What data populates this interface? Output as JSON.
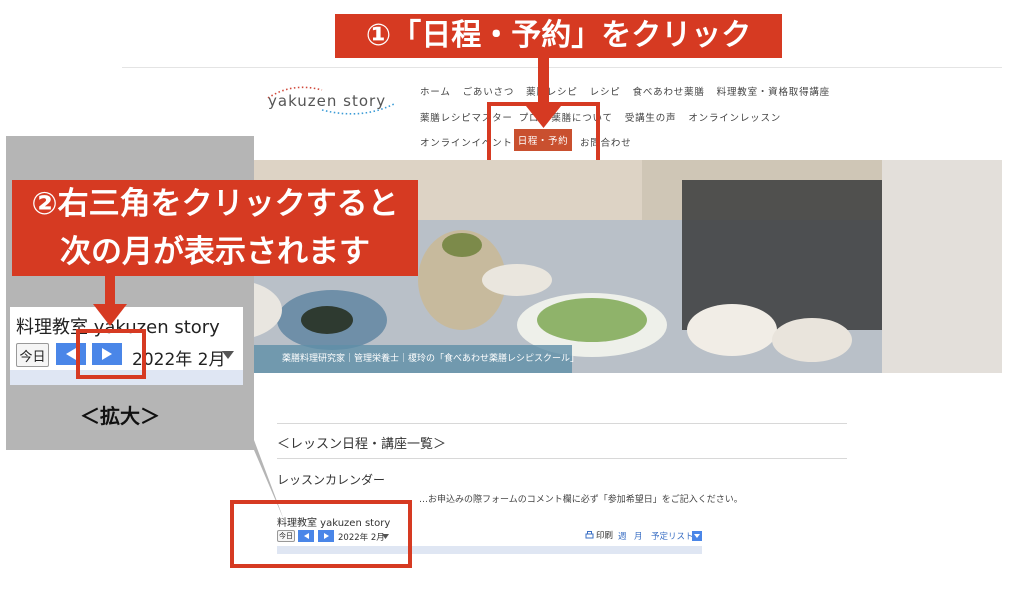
{
  "annotation_1": "①「日程・予約」をクリック",
  "annotation_2_line1": "②右三角をクリックすると",
  "annotation_2_line2": "次の月が表示されます",
  "zoom_caption": "＜拡大＞",
  "site": {
    "logo": "yakuzen story",
    "nav_row1": [
      "ホーム",
      "ごあいさつ",
      "薬膳レシピ",
      "レシピ",
      "食べあわせ薬膳",
      "料理教室・資格取得講座"
    ],
    "nav_row2": [
      "薬膳レシピマスター",
      "プロ",
      "薬膳について",
      "受講生の声",
      "オンラインレッスン"
    ],
    "nav_row3": [
      "オンラインイベント",
      "日程・予約",
      "お問合わせ"
    ],
    "hero_caption": "薬膳料理研究家｜管理栄養士｜榎玲の「食べあわせ薬膳レシピスクール」"
  },
  "zoom": {
    "calendar_title": "料理教室 yakuzen story",
    "today": "今日",
    "month": "2022年 2月"
  },
  "page": {
    "heading": "＜レッスン日程・講座一覧＞",
    "calendar_label": "レッスンカレンダー",
    "notice": "…お申込みの際フォームのコメント欄に必ず「参加希望日」をご記入ください。",
    "calendar_title": "料理教室 yakuzen story",
    "today": "今日",
    "month": "2022年 2月",
    "print": "印刷",
    "week": "週",
    "month_view": "月",
    "schedule_list": "予定リスト"
  },
  "colors": {
    "accent_red": "#d63a22",
    "button_blue": "#4a86e8",
    "nav_active": "#c9502f"
  }
}
